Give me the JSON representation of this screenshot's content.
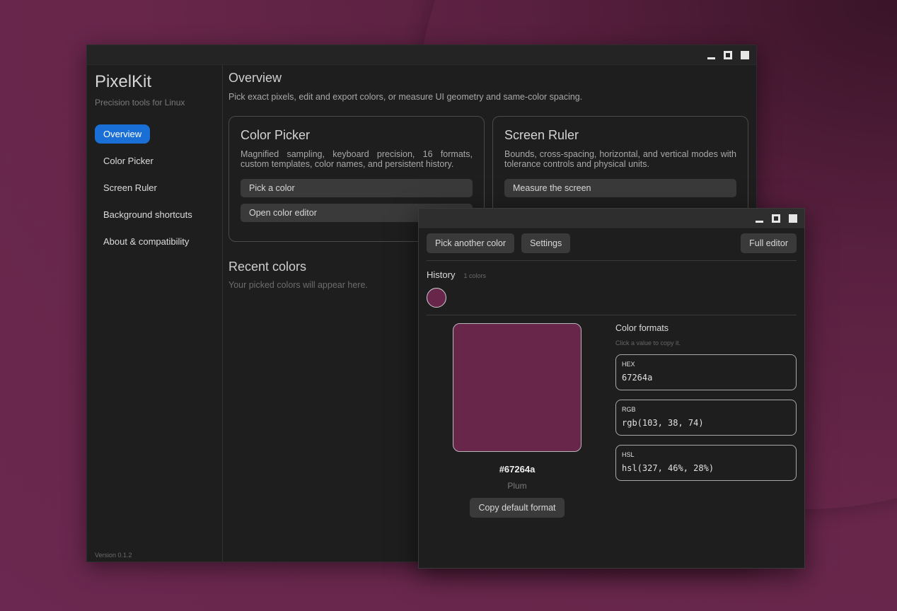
{
  "main_window": {
    "app_title": "PixelKit",
    "app_subtitle": "Precision tools for Linux",
    "nav": [
      "Overview",
      "Color Picker",
      "Screen Ruler",
      "Background shortcuts",
      "About & compatibility"
    ],
    "version": "Version 0.1.2",
    "overview_title": "Overview",
    "overview_desc": "Pick exact pixels, edit and export colors, or measure UI geometry and same-color spacing.",
    "cards": [
      {
        "title": "Color Picker",
        "desc": "Magnified sampling, keyboard precision, 16 formats, custom templates, color names, and persistent history.",
        "buttons": [
          "Pick a color",
          "Open color editor"
        ]
      },
      {
        "title": "Screen Ruler",
        "desc": "Bounds, cross-spacing, horizontal, and vertical modes with tolerance controls and physical units.",
        "buttons": [
          "Measure the screen"
        ]
      }
    ],
    "recent_title": "Recent colors",
    "recent_empty": "Your picked colors will appear here."
  },
  "picker_window": {
    "buttons": {
      "pick_another": "Pick another color",
      "settings": "Settings",
      "full_editor": "Full editor"
    },
    "history_title": "History",
    "history_count": "1 colors",
    "history_colors": [
      "#67264a"
    ],
    "current_color": "#67264a",
    "hex_label": "#67264a",
    "color_name": "Plum",
    "copy_button": "Copy default format",
    "formats_title": "Color formats",
    "formats_hint": "Click a value to copy it.",
    "formats": [
      {
        "key": "HEX",
        "value": "67264a"
      },
      {
        "key": "RGB",
        "value": "rgb(103, 38, 74)"
      },
      {
        "key": "HSL",
        "value": "hsl(327, 46%, 28%)"
      }
    ]
  },
  "colors": {
    "accent": "#1a6fd6",
    "desktop": "#67264a"
  }
}
